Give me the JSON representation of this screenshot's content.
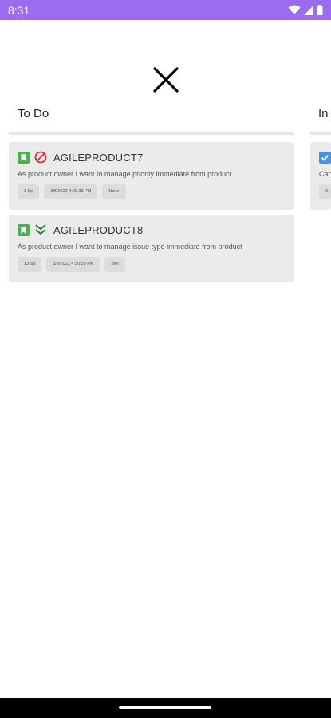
{
  "status_bar": {
    "time": "8:31"
  },
  "columns": [
    {
      "title": "To Do",
      "cards": [
        {
          "key": "AGILEPRODUCT7",
          "type_icon": "bookmark-icon",
          "priority_icon": "blocked-icon",
          "description": "As product owner I want to manage priority immediate from product",
          "chips": [
            "1 Sp",
            "3/5/2022 4:29:33 PM",
            "None"
          ]
        },
        {
          "key": "AGILEPRODUCT8",
          "type_icon": "bookmark-icon",
          "priority_icon": "double-chevron-down-icon",
          "description": "As product owner I want to manage issue type immediate from product",
          "chips": [
            "13 Sp",
            "3/5/2022 4:30:35 PM",
            "Bell"
          ]
        }
      ]
    },
    {
      "title": "In",
      "cards": [
        {
          "description": "Can",
          "chips": [
            "3"
          ]
        }
      ]
    }
  ],
  "colors": {
    "status_bar": "#9b6cf0",
    "card_bg": "#ebebeb",
    "story_green": "#4caf50",
    "blocked_red": "#d32f2f",
    "task_blue": "#4a90e2"
  }
}
